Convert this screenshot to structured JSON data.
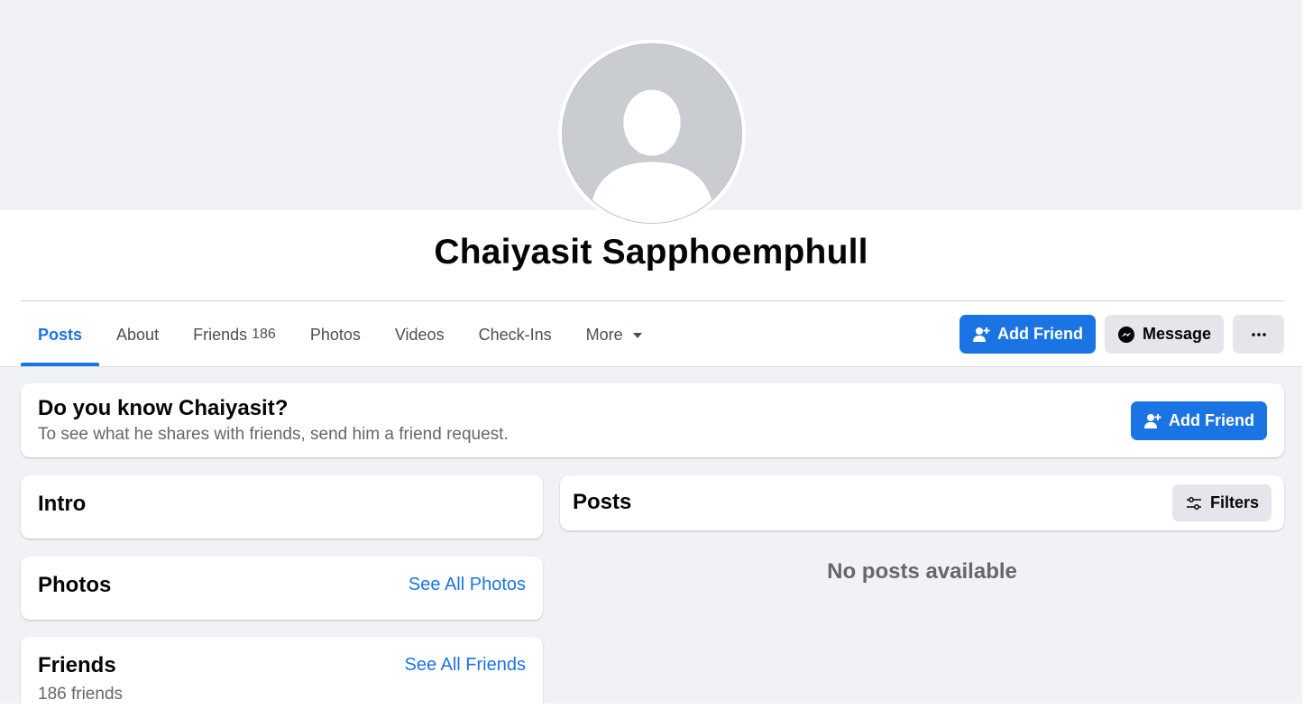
{
  "profile": {
    "name": "Chaiyasit Sapphoemphull",
    "avatar_icon": "default-avatar-silhouette"
  },
  "tabs": [
    {
      "label": "Posts",
      "active": true
    },
    {
      "label": "About"
    },
    {
      "label": "Friends",
      "count": "186"
    },
    {
      "label": "Photos"
    },
    {
      "label": "Videos"
    },
    {
      "label": "Check-Ins"
    },
    {
      "label": "More",
      "icon": "caret-down-icon"
    }
  ],
  "actions": {
    "add_friend": "Add Friend",
    "message": "Message",
    "more_icon": "ellipsis-icon"
  },
  "know": {
    "title": "Do you know Chaiyasit?",
    "subtitle": "To see what he shares with friends, send him a friend request.",
    "button": "Add Friend"
  },
  "intro": {
    "title": "Intro"
  },
  "photos": {
    "title": "Photos",
    "see_all": "See All Photos"
  },
  "friends": {
    "title": "Friends",
    "see_all": "See All Friends",
    "count_text": "186 friends"
  },
  "posts": {
    "title": "Posts",
    "filters": "Filters",
    "empty": "No posts available"
  },
  "colors": {
    "accent": "#1b74e4",
    "background": "#f0f2f5",
    "button_gray": "#e4e6eb",
    "secondary_text": "#65676b"
  }
}
